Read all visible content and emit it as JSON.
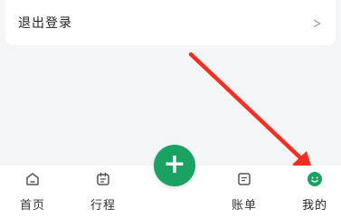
{
  "menu": {
    "logout_label": "退出登录",
    "chevron_icon": "chevron-right-icon"
  },
  "fab": {
    "icon": "plus-icon",
    "symbol": "+",
    "color": "#1aa262"
  },
  "tabs": [
    {
      "label": "首页",
      "icon": "home-icon"
    },
    {
      "label": "行程",
      "icon": "calendar-icon"
    },
    {
      "label": "账单",
      "icon": "bill-icon"
    },
    {
      "label": "我的",
      "icon": "smiley-icon",
      "active": true
    }
  ],
  "colors": {
    "accent": "#1aa262",
    "annotation_arrow": "#ff2d1f",
    "background": "#f4f5f7"
  }
}
